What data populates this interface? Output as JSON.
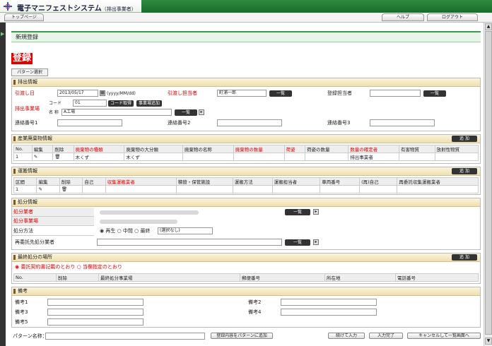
{
  "app": {
    "title": "電子マニフェストシステム",
    "subtitle": "（排出事業者）"
  },
  "nav": {
    "top_page": "トップページ",
    "help": "ヘルプ",
    "logout": "ログアウト"
  },
  "page": {
    "heading": "新規登録",
    "mode": "登録",
    "pattern_tab": "パターン選択"
  },
  "emission": {
    "title": "排出情報",
    "hikiwatashi_date_label": "引渡し日",
    "date_value": "2013/05/17",
    "date_hint": "(yyyy/MM/dd)",
    "tantou_label": "引渡し担当者",
    "tantou_value": "町浦一郎",
    "list_btn": "一覧",
    "touroku_tantou_label": "登録担当者",
    "jigyoujou_label": "排出事業場",
    "code_label": "コード",
    "code_value": "01",
    "code_btn": "コード取得",
    "jigyoujou_add_btn": "事業場追加",
    "name_label": "名 称",
    "name_value": "A工場",
    "renraku1": "連絡番号1",
    "renraku2": "連絡番号2",
    "renraku3": "連絡番号3"
  },
  "waste": {
    "title": "産業廃棄物情報",
    "add_btn": "追 加",
    "headers": [
      "No.",
      "編集",
      "削除",
      "廃棄物の種類",
      "廃棄物の大分類",
      "廃棄物の名称",
      "廃棄物の数量",
      "荷姿",
      "荷姿の数量",
      "数量の確定者",
      "有害物質",
      "放射性物質"
    ],
    "row": {
      "no": "1",
      "kind": "木くず",
      "category": "木くず",
      "confirmer": "排出事業者"
    }
  },
  "transport": {
    "title": "運搬情報",
    "add_btn": "追 加",
    "headers": [
      "区間",
      "編集",
      "削除",
      "自己",
      "収集運搬業者",
      "積替・保管施設",
      "運搬方法",
      "運搬担当者",
      "車両番号",
      "(再)自己",
      "再委託収集運搬業者"
    ],
    "row": {
      "no": "1"
    }
  },
  "disposal": {
    "title": "処分情報",
    "company_label": "処分業者",
    "site_label": "処分事業場",
    "method_label": "処分方法",
    "opt1": "再生",
    "opt2": "中間",
    "opt3": "最終",
    "select_value": "(選択なし)",
    "resub_label": "再委託先処分業者",
    "list_btn": "一覧"
  },
  "final": {
    "title": "最終処分の場所",
    "add_btn": "追 加",
    "opt1": "委託契約書記載のとおり",
    "opt2": "当欄指定のとおり",
    "headers": [
      "No.",
      "削除",
      "最終処分事業場",
      "郵便番号",
      "所在地",
      "電話番号"
    ]
  },
  "remarks": {
    "title": "備考",
    "b1": "備考1",
    "b2": "備考2",
    "b3": "備考3",
    "b4": "備考4",
    "b5": "備考5"
  },
  "footer": {
    "pattern_label": "パターン名称：",
    "save_pattern": "登録内容をパターンに追加",
    "continue": "続けて入力",
    "complete": "入力完了",
    "cancel": "キャンセルして一覧画面へ"
  },
  "colors": {
    "accent_green": "#2e8b3e",
    "required_red": "#e00000",
    "section_gold": "#f0e0b0"
  }
}
